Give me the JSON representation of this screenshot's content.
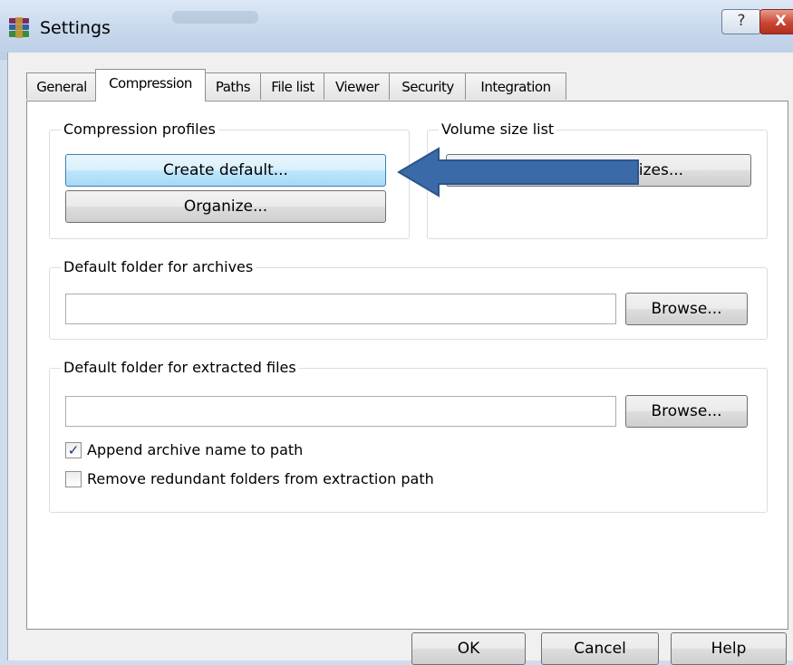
{
  "window": {
    "title": "Settings",
    "help_glyph": "?",
    "close_glyph": "X"
  },
  "tabs": [
    {
      "label": "General"
    },
    {
      "label": "Compression"
    },
    {
      "label": "Paths"
    },
    {
      "label": "File list"
    },
    {
      "label": "Viewer"
    },
    {
      "label": "Security"
    },
    {
      "label": "Integration"
    }
  ],
  "compression_profiles": {
    "label": "Compression profiles",
    "create_default": "Create default...",
    "organize": "Organize..."
  },
  "volume_size_list": {
    "label": "Volume size list",
    "define_sizes_visible": "sizes..."
  },
  "archives_folder": {
    "label": "Default folder for archives",
    "value": "",
    "browse": "Browse..."
  },
  "extracted_folder": {
    "label": "Default folder for extracted files",
    "value": "",
    "browse": "Browse...",
    "append_name": {
      "label": "Append archive name to path",
      "checked": true
    },
    "remove_redundant": {
      "label": "Remove redundant folders from extraction path",
      "checked": false
    }
  },
  "footer": {
    "ok": "OK",
    "cancel": "Cancel",
    "help": "Help"
  },
  "annotation": {
    "icon": "arrow-left-icon",
    "color": "#3b6aa8"
  }
}
